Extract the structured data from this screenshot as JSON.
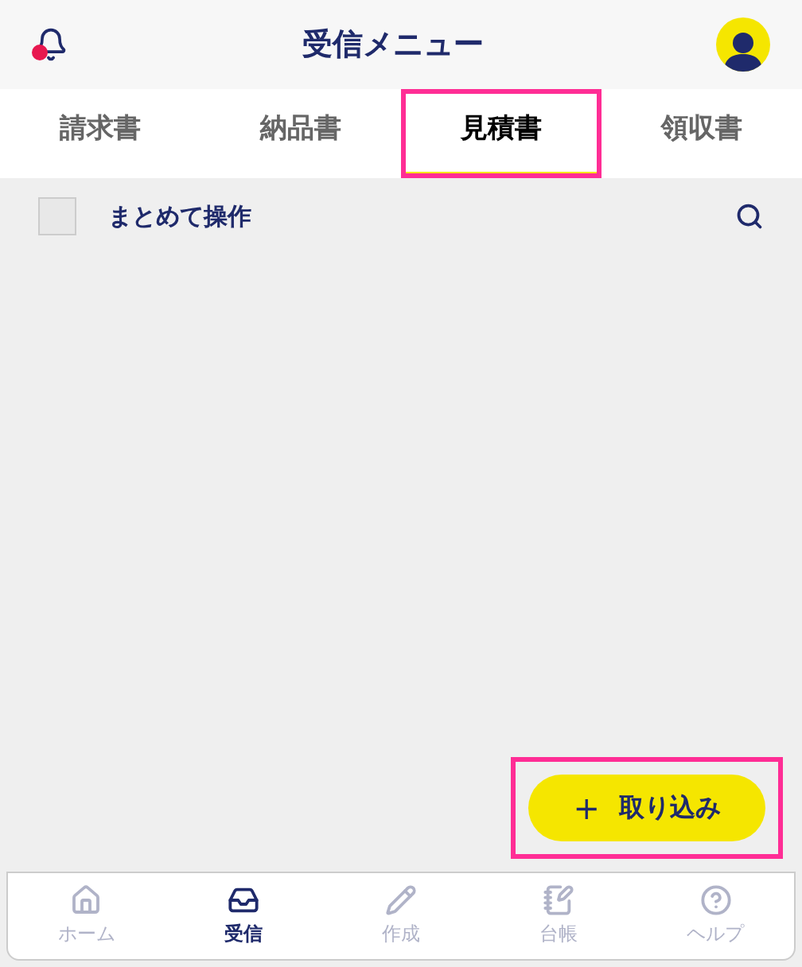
{
  "header": {
    "title": "受信メニュー"
  },
  "tabs": [
    {
      "label": "請求書",
      "selected": false,
      "highlighted": false
    },
    {
      "label": "納品書",
      "selected": false,
      "highlighted": false
    },
    {
      "label": "見積書",
      "selected": true,
      "highlighted": true
    },
    {
      "label": "領収書",
      "selected": false,
      "highlighted": false
    }
  ],
  "toolbar": {
    "bulk_label": "まとめて操作",
    "checked": false
  },
  "import_button": {
    "label": "取り込み",
    "icon": "+",
    "highlighted": true
  },
  "bottom_nav": [
    {
      "kind": "home",
      "label": "ホーム",
      "selected": false
    },
    {
      "kind": "inbox",
      "label": "受信",
      "selected": true
    },
    {
      "kind": "create",
      "label": "作成",
      "selected": false
    },
    {
      "kind": "ledger",
      "label": "台帳",
      "selected": false
    },
    {
      "kind": "help",
      "label": "ヘルプ",
      "selected": false
    }
  ]
}
